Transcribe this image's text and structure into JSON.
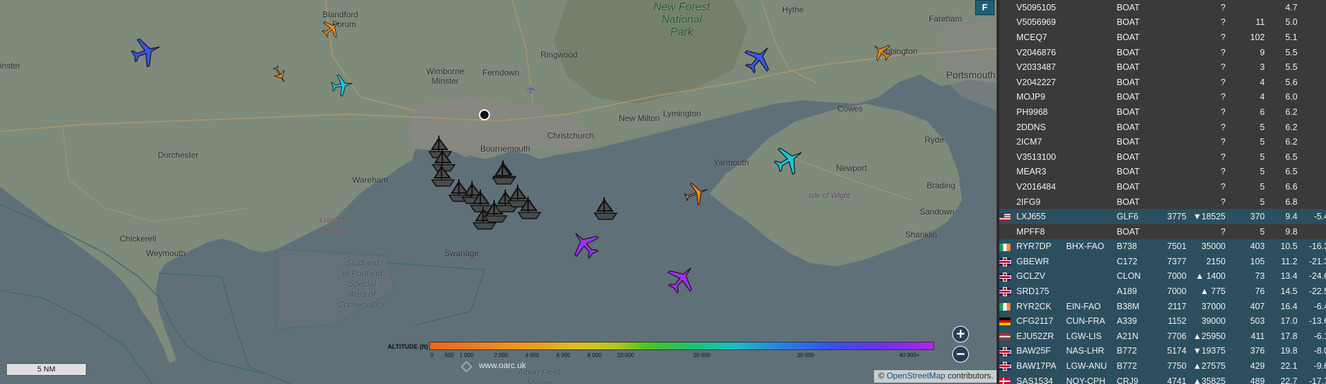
{
  "map": {
    "f_button": "F",
    "zoom_in": "+",
    "zoom_out": "−",
    "scale_label": "5 NM",
    "oarc_link": "www.oarc.uk",
    "attribution_prefix": "© ",
    "attribution_link": "OpenStreetMap",
    "attribution_suffix": " contributors.",
    "places": {
      "blandford": "Blandford",
      "forum": "Forum",
      "inster": "inster",
      "new_forest_1": "New Forest",
      "new_forest_2": "National",
      "new_forest_3": "Park",
      "hythe": "Hythe",
      "fareham": "Fareham",
      "ibbington": "ibbington",
      "portsmouth": "Portsmouth",
      "ringwood": "Ringwood",
      "wimborne_1": "Wimborne",
      "wimborne_2": "Minster",
      "ferndown": "Ferndown",
      "lymington": "Lymington",
      "cowes": "Cowes",
      "new_milton": "New Milton",
      "christchurch": "Christchurch",
      "ryde": "Ryde",
      "bournemouth": "Bournemouth",
      "dorchester": "Dorchester",
      "wareham": "Wareham",
      "yarmouth": "Yarmouth",
      "newport": "Newport",
      "brading": "Brading",
      "isle_of_wight": "Isle of Wight",
      "sandown": "Sandown",
      "lulworth_1": "Lulworth",
      "lulworth_2": "Ranges",
      "shanklin": "Shanklin",
      "chickerell": "Chickerell",
      "weymouth": "Weymouth",
      "swanage": "Swanage",
      "studland_1": "Studland",
      "studland_2": "to Portland",
      "studland_3": "Special",
      "studland_4": "Area of",
      "studland_5": "Conservation",
      "albert_field": "Albert Field",
      "marine": "Marine"
    },
    "altitude_legend": {
      "title": "ALTITUDE (ft)",
      "ticks": [
        "0",
        "500",
        "1 000",
        "2 000",
        "4 000",
        "6 000",
        "8 000",
        "10 000",
        "20 000",
        "30 000",
        "40 000+"
      ]
    },
    "plane_colors": {
      "blue": "#3a57e6",
      "orange": "#f08a1a",
      "cyan": "#1ec6d6",
      "purple": "#a230f0"
    }
  },
  "table": {
    "rows": [
      {
        "flag": "none",
        "callsign": "V5095105",
        "route": "",
        "type": "BOAT",
        "squawk": "",
        "altitude": "?",
        "speed": "",
        "distance": "4.7",
        "rssi": ""
      },
      {
        "flag": "none",
        "callsign": "V5056969",
        "route": "",
        "type": "BOAT",
        "squawk": "",
        "altitude": "?",
        "speed": "11",
        "distance": "5.0",
        "rssi": ""
      },
      {
        "flag": "none",
        "callsign": "MCEQ7",
        "route": "",
        "type": "BOAT",
        "squawk": "",
        "altitude": "?",
        "speed": "102",
        "distance": "5.1",
        "rssi": ""
      },
      {
        "flag": "none",
        "callsign": "V2046876",
        "route": "",
        "type": "BOAT",
        "squawk": "",
        "altitude": "?",
        "speed": "9",
        "distance": "5.5",
        "rssi": ""
      },
      {
        "flag": "none",
        "callsign": "V2033487",
        "route": "",
        "type": "BOAT",
        "squawk": "",
        "altitude": "?",
        "speed": "3",
        "distance": "5.5",
        "rssi": ""
      },
      {
        "flag": "none",
        "callsign": "V2042227",
        "route": "",
        "type": "BOAT",
        "squawk": "",
        "altitude": "?",
        "speed": "4",
        "distance": "5.6",
        "rssi": ""
      },
      {
        "flag": "none",
        "callsign": "MOJP9",
        "route": "",
        "type": "BOAT",
        "squawk": "",
        "altitude": "?",
        "speed": "4",
        "distance": "6.0",
        "rssi": ""
      },
      {
        "flag": "none",
        "callsign": "PH9968",
        "route": "",
        "type": "BOAT",
        "squawk": "",
        "altitude": "?",
        "speed": "6",
        "distance": "6.2",
        "rssi": ""
      },
      {
        "flag": "none",
        "callsign": "2DDNS",
        "route": "",
        "type": "BOAT",
        "squawk": "",
        "altitude": "?",
        "speed": "5",
        "distance": "6.2",
        "rssi": ""
      },
      {
        "flag": "none",
        "callsign": "2ICM7",
        "route": "",
        "type": "BOAT",
        "squawk": "",
        "altitude": "?",
        "speed": "5",
        "distance": "6.2",
        "rssi": ""
      },
      {
        "flag": "none",
        "callsign": "V3513100",
        "route": "",
        "type": "BOAT",
        "squawk": "",
        "altitude": "?",
        "speed": "5",
        "distance": "6.5",
        "rssi": ""
      },
      {
        "flag": "none",
        "callsign": "MEAR3",
        "route": "",
        "type": "BOAT",
        "squawk": "",
        "altitude": "?",
        "speed": "5",
        "distance": "6.5",
        "rssi": ""
      },
      {
        "flag": "none",
        "callsign": "V2016484",
        "route": "",
        "type": "BOAT",
        "squawk": "",
        "altitude": "?",
        "speed": "5",
        "distance": "6.6",
        "rssi": ""
      },
      {
        "flag": "none",
        "callsign": "2IFG9",
        "route": "",
        "type": "BOAT",
        "squawk": "",
        "altitude": "?",
        "speed": "5",
        "distance": "6.8",
        "rssi": ""
      },
      {
        "flag": "us",
        "callsign": "LXJ655",
        "route": "",
        "type": "GLF6",
        "squawk": "3775",
        "altitude": "▼18525",
        "speed": "370",
        "distance": "9.4",
        "rssi": "-5.4",
        "cls": "sel"
      },
      {
        "flag": "none",
        "callsign": "MPFF8",
        "route": "",
        "type": "BOAT",
        "squawk": "",
        "altitude": "?",
        "speed": "5",
        "distance": "9.8",
        "rssi": ""
      },
      {
        "flag": "ie",
        "callsign": "RYR7DP",
        "route": "BHX-FAO",
        "type": "B738",
        "squawk": "7501",
        "altitude": "35000",
        "speed": "403",
        "distance": "10.5",
        "rssi": "-16.3",
        "cls": "air"
      },
      {
        "flag": "gb",
        "callsign": "GBEWR",
        "route": "",
        "type": "C172",
        "squawk": "7377",
        "altitude": "2150",
        "speed": "105",
        "distance": "11.2",
        "rssi": "-21.3",
        "cls": "air"
      },
      {
        "flag": "gb",
        "callsign": "GCLZV",
        "route": "",
        "type": "CLON",
        "squawk": "7000",
        "altitude": "▲ 1400",
        "speed": "73",
        "distance": "13.4",
        "rssi": "-24.6",
        "cls": "air"
      },
      {
        "flag": "gb",
        "callsign": "SRD175",
        "route": "",
        "type": "A189",
        "squawk": "7000",
        "altitude": "▲ 775",
        "speed": "76",
        "distance": "14.5",
        "rssi": "-22.5",
        "cls": "air"
      },
      {
        "flag": "ie",
        "callsign": "RYR2CK",
        "route": "EIN-FAO",
        "type": "B38M",
        "squawk": "2117",
        "altitude": "37000",
        "speed": "407",
        "distance": "16.4",
        "rssi": "-6.4",
        "cls": "air"
      },
      {
        "flag": "de",
        "callsign": "CFG2117",
        "route": "CUN-FRA",
        "type": "A339",
        "squawk": "1152",
        "altitude": "39000",
        "speed": "503",
        "distance": "17.0",
        "rssi": "-13.6",
        "cls": "air"
      },
      {
        "flag": "lv",
        "callsign": "EJU52ZR",
        "route": "LGW-LIS",
        "type": "A21N",
        "squawk": "7706",
        "altitude": "▲25950",
        "speed": "411",
        "distance": "17.8",
        "rssi": "-6.1",
        "cls": "air"
      },
      {
        "flag": "gb",
        "callsign": "BAW25F",
        "route": "NAS-LHR",
        "type": "B772",
        "squawk": "5174",
        "altitude": "▼19375",
        "speed": "376",
        "distance": "19.8",
        "rssi": "-8.0",
        "cls": "air"
      },
      {
        "flag": "gb",
        "callsign": "BAW17PA",
        "route": "LGW-ANU",
        "type": "B772",
        "squawk": "7750",
        "altitude": "▲27575",
        "speed": "429",
        "distance": "22.1",
        "rssi": "-9.6",
        "cls": "air"
      },
      {
        "flag": "dk",
        "callsign": "SAS1534",
        "route": "NQY-CPH",
        "type": "CRJ9",
        "squawk": "4741",
        "altitude": "▲35825",
        "speed": "489",
        "distance": "22.7",
        "rssi": "-17.7",
        "cls": "air"
      }
    ]
  }
}
